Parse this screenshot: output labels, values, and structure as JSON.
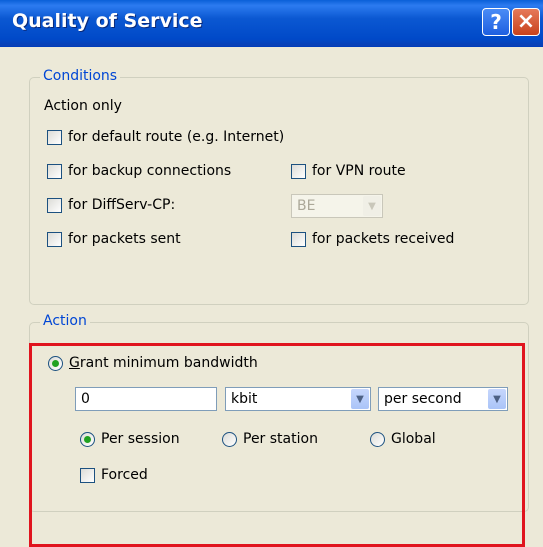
{
  "window": {
    "title": "Quality of Service",
    "help_label": "?",
    "close_label": "×"
  },
  "conditions": {
    "legend": "Conditions",
    "action_only": "Action only",
    "default_route": "for default route (e.g. Internet)",
    "backup": "for backup connections",
    "vpn": "for VPN route",
    "diffserv": "for DiffServ-CP:",
    "diffserv_value": "BE",
    "packets_sent": "for packets sent",
    "packets_received": "for packets received"
  },
  "action": {
    "legend": "Action",
    "grant_prefix": "G",
    "grant_rest": "rant minimum bandwidth",
    "bandwidth_value": "0",
    "unit": "kbit",
    "period": "per second",
    "per_session": "Per session",
    "per_station": "Per station",
    "global": "Global",
    "forced": "Forced"
  },
  "colors": {
    "title_bar": "#0049c8",
    "group_legend": "#0046d5",
    "highlight_border": "#e0141e",
    "radio_dot": "#21a121"
  }
}
